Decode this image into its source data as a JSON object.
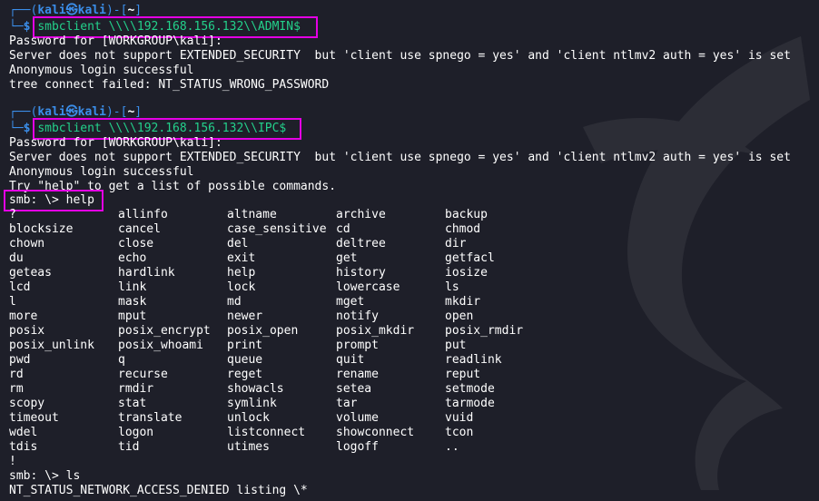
{
  "prompt1": {
    "user": "kali",
    "at": "㉿",
    "host": "kali",
    "dir": "~",
    "command": "smbclient \\\\\\\\192.168.156.132\\\\ADMIN$"
  },
  "prompt2": {
    "user": "kali",
    "at": "㉿",
    "host": "kali",
    "dir": "~",
    "command": "smbclient \\\\\\\\192.168.156.132\\\\IPC$"
  },
  "output1": [
    "Password for [WORKGROUP\\kali]:",
    "Server does not support EXTENDED_SECURITY  but 'client use spnego = yes' and 'client ntlmv2 auth = yes' is set",
    "Anonymous login successful",
    "tree connect failed: NT_STATUS_WRONG_PASSWORD"
  ],
  "output2": [
    "Password for [WORKGROUP\\kali]:",
    "Server does not support EXTENDED_SECURITY  but 'client use spnego = yes' and 'client ntlmv2 auth = yes' is set",
    "Anonymous login successful",
    "Try \"help\" to get a list of possible commands."
  ],
  "smb_help": "smb: \\> help",
  "commands": [
    [
      "?",
      "allinfo",
      "altname",
      "archive",
      "backup"
    ],
    [
      "blocksize",
      "cancel",
      "case_sensitive",
      "cd",
      "chmod"
    ],
    [
      "chown",
      "close",
      "del",
      "deltree",
      "dir"
    ],
    [
      "du",
      "echo",
      "exit",
      "get",
      "getfacl"
    ],
    [
      "geteas",
      "hardlink",
      "help",
      "history",
      "iosize"
    ],
    [
      "lcd",
      "link",
      "lock",
      "lowercase",
      "ls"
    ],
    [
      "l",
      "mask",
      "md",
      "mget",
      "mkdir"
    ],
    [
      "more",
      "mput",
      "newer",
      "notify",
      "open"
    ],
    [
      "posix",
      "posix_encrypt",
      "posix_open",
      "posix_mkdir",
      "posix_rmdir"
    ],
    [
      "posix_unlink",
      "posix_whoami",
      "print",
      "prompt",
      "put"
    ],
    [
      "pwd",
      "q",
      "queue",
      "quit",
      "readlink"
    ],
    [
      "rd",
      "recurse",
      "reget",
      "rename",
      "reput"
    ],
    [
      "rm",
      "rmdir",
      "showacls",
      "setea",
      "setmode"
    ],
    [
      "scopy",
      "stat",
      "symlink",
      "tar",
      "tarmode"
    ],
    [
      "timeout",
      "translate",
      "unlock",
      "volume",
      "vuid"
    ],
    [
      "wdel",
      "logon",
      "listconnect",
      "showconnect",
      "tcon"
    ],
    [
      "tdis",
      "tid",
      "utimes",
      "logoff",
      ".."
    ],
    [
      "!"
    ]
  ],
  "smb_ls": "smb: \\> ls",
  "ls_error": "NT_STATUS_NETWORK_ACCESS_DENIED listing \\*",
  "colors": {
    "background": "#1e1f29",
    "prompt_blue": "#3b8eea",
    "command_green": "#23d18b",
    "highlight": "#e400e4"
  }
}
